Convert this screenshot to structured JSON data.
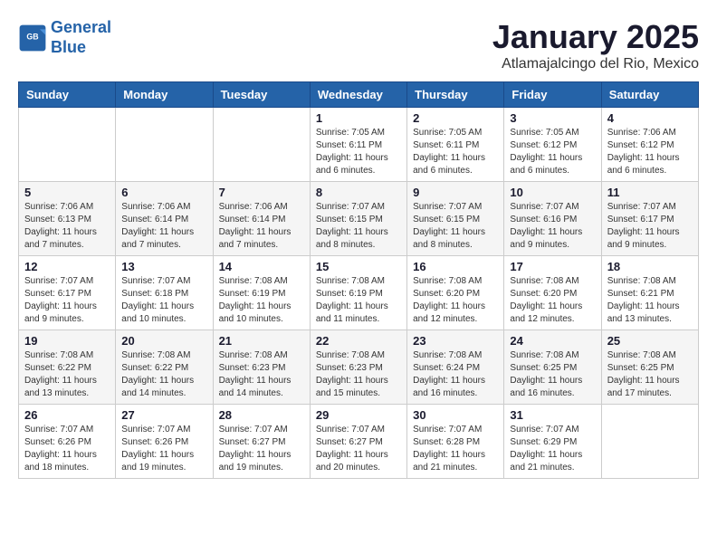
{
  "header": {
    "logo_line1": "General",
    "logo_line2": "Blue",
    "title": "January 2025",
    "subtitle": "Atlamajalcingo del Rio, Mexico"
  },
  "weekdays": [
    "Sunday",
    "Monday",
    "Tuesday",
    "Wednesday",
    "Thursday",
    "Friday",
    "Saturday"
  ],
  "weeks": [
    [
      {
        "day": "",
        "info": ""
      },
      {
        "day": "",
        "info": ""
      },
      {
        "day": "",
        "info": ""
      },
      {
        "day": "1",
        "info": "Sunrise: 7:05 AM\nSunset: 6:11 PM\nDaylight: 11 hours\nand 6 minutes."
      },
      {
        "day": "2",
        "info": "Sunrise: 7:05 AM\nSunset: 6:11 PM\nDaylight: 11 hours\nand 6 minutes."
      },
      {
        "day": "3",
        "info": "Sunrise: 7:05 AM\nSunset: 6:12 PM\nDaylight: 11 hours\nand 6 minutes."
      },
      {
        "day": "4",
        "info": "Sunrise: 7:06 AM\nSunset: 6:12 PM\nDaylight: 11 hours\nand 6 minutes."
      }
    ],
    [
      {
        "day": "5",
        "info": "Sunrise: 7:06 AM\nSunset: 6:13 PM\nDaylight: 11 hours\nand 7 minutes."
      },
      {
        "day": "6",
        "info": "Sunrise: 7:06 AM\nSunset: 6:14 PM\nDaylight: 11 hours\nand 7 minutes."
      },
      {
        "day": "7",
        "info": "Sunrise: 7:06 AM\nSunset: 6:14 PM\nDaylight: 11 hours\nand 7 minutes."
      },
      {
        "day": "8",
        "info": "Sunrise: 7:07 AM\nSunset: 6:15 PM\nDaylight: 11 hours\nand 8 minutes."
      },
      {
        "day": "9",
        "info": "Sunrise: 7:07 AM\nSunset: 6:15 PM\nDaylight: 11 hours\nand 8 minutes."
      },
      {
        "day": "10",
        "info": "Sunrise: 7:07 AM\nSunset: 6:16 PM\nDaylight: 11 hours\nand 9 minutes."
      },
      {
        "day": "11",
        "info": "Sunrise: 7:07 AM\nSunset: 6:17 PM\nDaylight: 11 hours\nand 9 minutes."
      }
    ],
    [
      {
        "day": "12",
        "info": "Sunrise: 7:07 AM\nSunset: 6:17 PM\nDaylight: 11 hours\nand 9 minutes."
      },
      {
        "day": "13",
        "info": "Sunrise: 7:07 AM\nSunset: 6:18 PM\nDaylight: 11 hours\nand 10 minutes."
      },
      {
        "day": "14",
        "info": "Sunrise: 7:08 AM\nSunset: 6:19 PM\nDaylight: 11 hours\nand 10 minutes."
      },
      {
        "day": "15",
        "info": "Sunrise: 7:08 AM\nSunset: 6:19 PM\nDaylight: 11 hours\nand 11 minutes."
      },
      {
        "day": "16",
        "info": "Sunrise: 7:08 AM\nSunset: 6:20 PM\nDaylight: 11 hours\nand 12 minutes."
      },
      {
        "day": "17",
        "info": "Sunrise: 7:08 AM\nSunset: 6:20 PM\nDaylight: 11 hours\nand 12 minutes."
      },
      {
        "day": "18",
        "info": "Sunrise: 7:08 AM\nSunset: 6:21 PM\nDaylight: 11 hours\nand 13 minutes."
      }
    ],
    [
      {
        "day": "19",
        "info": "Sunrise: 7:08 AM\nSunset: 6:22 PM\nDaylight: 11 hours\nand 13 minutes."
      },
      {
        "day": "20",
        "info": "Sunrise: 7:08 AM\nSunset: 6:22 PM\nDaylight: 11 hours\nand 14 minutes."
      },
      {
        "day": "21",
        "info": "Sunrise: 7:08 AM\nSunset: 6:23 PM\nDaylight: 11 hours\nand 14 minutes."
      },
      {
        "day": "22",
        "info": "Sunrise: 7:08 AM\nSunset: 6:23 PM\nDaylight: 11 hours\nand 15 minutes."
      },
      {
        "day": "23",
        "info": "Sunrise: 7:08 AM\nSunset: 6:24 PM\nDaylight: 11 hours\nand 16 minutes."
      },
      {
        "day": "24",
        "info": "Sunrise: 7:08 AM\nSunset: 6:25 PM\nDaylight: 11 hours\nand 16 minutes."
      },
      {
        "day": "25",
        "info": "Sunrise: 7:08 AM\nSunset: 6:25 PM\nDaylight: 11 hours\nand 17 minutes."
      }
    ],
    [
      {
        "day": "26",
        "info": "Sunrise: 7:07 AM\nSunset: 6:26 PM\nDaylight: 11 hours\nand 18 minutes."
      },
      {
        "day": "27",
        "info": "Sunrise: 7:07 AM\nSunset: 6:26 PM\nDaylight: 11 hours\nand 19 minutes."
      },
      {
        "day": "28",
        "info": "Sunrise: 7:07 AM\nSunset: 6:27 PM\nDaylight: 11 hours\nand 19 minutes."
      },
      {
        "day": "29",
        "info": "Sunrise: 7:07 AM\nSunset: 6:27 PM\nDaylight: 11 hours\nand 20 minutes."
      },
      {
        "day": "30",
        "info": "Sunrise: 7:07 AM\nSunset: 6:28 PM\nDaylight: 11 hours\nand 21 minutes."
      },
      {
        "day": "31",
        "info": "Sunrise: 7:07 AM\nSunset: 6:29 PM\nDaylight: 11 hours\nand 21 minutes."
      },
      {
        "day": "",
        "info": ""
      }
    ]
  ]
}
